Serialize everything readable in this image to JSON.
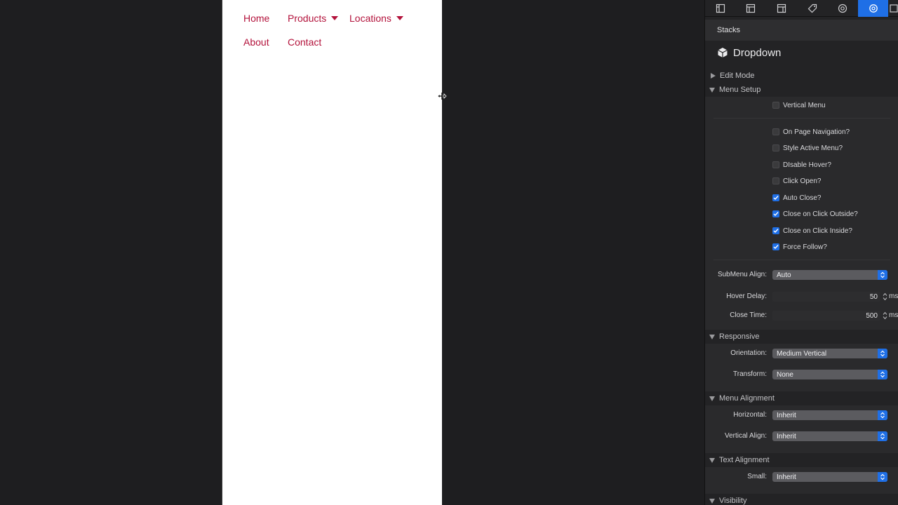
{
  "preview": {
    "nav": [
      {
        "label": "Home",
        "dropdown": false
      },
      {
        "label": "Products",
        "dropdown": true
      },
      {
        "label": "Locations",
        "dropdown": true
      },
      {
        "label": "About",
        "dropdown": false
      },
      {
        "label": "Contact",
        "dropdown": false
      }
    ],
    "link_color": "#b3123b"
  },
  "toolbar": {
    "buttons": [
      "page-inspector-icon",
      "layout-inspector-icon",
      "site-inspector-icon",
      "tag-icon",
      "at-sign-icon",
      "stack-settings-icon"
    ],
    "active_index": 5,
    "accent": "#1f6fe6"
  },
  "panel": {
    "header": "Stacks",
    "title": "Dropdown",
    "sections": {
      "edit_mode": "Edit Mode",
      "menu_setup": "Menu Setup",
      "responsive": "Responsive",
      "menu_alignment": "Menu Alignment",
      "text_alignment": "Text Alignment",
      "visibility": "Visibility"
    },
    "checkboxes": [
      {
        "label": "Vertical Menu",
        "checked": false
      },
      {
        "label": "On Page Navigation?",
        "checked": false
      },
      {
        "label": "Style Active Menu?",
        "checked": false
      },
      {
        "label": "DIsable Hover?",
        "checked": false
      },
      {
        "label": "Click Open?",
        "checked": false
      },
      {
        "label": "Auto Close?",
        "checked": true
      },
      {
        "label": "Close on Click Outside?",
        "checked": true
      },
      {
        "label": "Close on Click Inside?",
        "checked": true
      },
      {
        "label": "Force Follow?",
        "checked": true
      }
    ],
    "submenu_align": {
      "label": "SubMenu Align:",
      "value": "Auto"
    },
    "hover_delay": {
      "label": "Hover Delay:",
      "value": "50",
      "unit": "ms"
    },
    "close_time": {
      "label": "Close Time:",
      "value": "500",
      "unit": "ms"
    },
    "orientation": {
      "label": "Orientation:",
      "value": "Medium Vertical"
    },
    "transform": {
      "label": "Transform:",
      "value": "None"
    },
    "horizontal": {
      "label": "Horizontal:",
      "value": "Inherit"
    },
    "vertical_align": {
      "label": "Vertical Align:",
      "value": "Inherit"
    },
    "small": {
      "label": "Small:",
      "value": "Inherit"
    }
  }
}
